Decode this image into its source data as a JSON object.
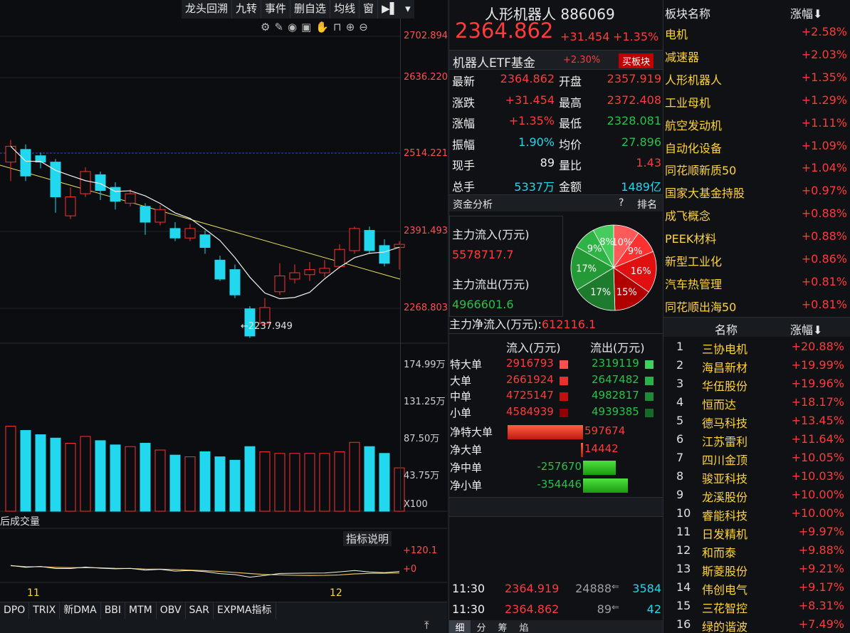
{
  "toolbar": {
    "items": [
      "龙头回溯",
      "九转",
      "事件",
      "删自选",
      "均线",
      "窗"
    ]
  },
  "price_axis": [
    "2702.894",
    "2636.220",
    "2514.221",
    "2391.493",
    "2268.803"
  ],
  "low_label": "2237.949",
  "volume_axis": [
    "174.99万",
    "131.25万",
    "87.50万",
    "43.75万"
  ],
  "volume_unit": "X100",
  "volume_caption": "后成交量",
  "indicator_axis": [
    "+120.1",
    "+0"
  ],
  "indicator_button": "指标说明",
  "time_labels": [
    "11",
    "12"
  ],
  "bottom_tabs": [
    "DPO",
    "TRIX",
    "新DMA",
    "BBI",
    "MTM",
    "OBV",
    "SAR",
    "EXPMA指标"
  ],
  "quote": {
    "name": "人形机器人 886069",
    "price": "2364.862",
    "change": "+31.454",
    "change_pct": "+1.35%",
    "etf_name": "机器人ETF基金",
    "etf_pct": "+2.30%",
    "buy_button": "买板块",
    "fields": [
      {
        "k1": "最新",
        "v1": "2364.862",
        "k2": "开盘",
        "v2": "2357.919",
        "c1": "red",
        "c2": "red"
      },
      {
        "k1": "涨跌",
        "v1": "+31.454",
        "k2": "最高",
        "v2": "2372.408",
        "c1": "red",
        "c2": "red"
      },
      {
        "k1": "涨幅",
        "v1": "+1.35%",
        "k2": "最低",
        "v2": "2328.081",
        "c1": "red",
        "c2": "green"
      },
      {
        "k1": "振幅",
        "v1": "1.90%",
        "k2": "均价",
        "v2": "27.896",
        "c1": "cyan",
        "c2": "green"
      },
      {
        "k1": "现手",
        "v1": "89",
        "k2": "量比",
        "v2": "1.43",
        "c1": "white",
        "c2": "red"
      },
      {
        "k1": "总手",
        "v1": "5337万",
        "k2": "金额",
        "v2": "1489亿",
        "c1": "cyan",
        "c2": "cyan"
      }
    ]
  },
  "fund": {
    "title": "资金分析",
    "help": "?",
    "rank": "排名",
    "inflow_label": "主力流入(万元)",
    "inflow_value": "5578717.7",
    "outflow_label": "主力流出(万元)",
    "outflow_value": "4966601.6",
    "net_label": "主力净流入(万元):",
    "net_value": "612116.1",
    "pie": [
      {
        "label": "10%",
        "value": 10,
        "color": "#ff5a5a"
      },
      {
        "label": "9%",
        "value": 9,
        "color": "#ff3030"
      },
      {
        "label": "16%",
        "value": 16,
        "color": "#e01010"
      },
      {
        "label": "15%",
        "value": 15,
        "color": "#b00000"
      },
      {
        "label": "17%",
        "value": 17,
        "color": "#1e7a2c"
      },
      {
        "label": "17%",
        "value": 17,
        "color": "#249a36"
      },
      {
        "label": "9%",
        "value": 9,
        "color": "#2eb444"
      },
      {
        "label": "8%",
        "value": 8,
        "color": "#46cc5c"
      }
    ],
    "col_in": "流入(万元)",
    "col_out": "流出(万元)",
    "rows": [
      {
        "name": "特大单",
        "in": "2916793",
        "out": "2319119"
      },
      {
        "name": "大单",
        "in": "2661924",
        "out": "2647482"
      },
      {
        "name": "中单",
        "in": "4725147",
        "out": "4982817"
      },
      {
        "name": "小单",
        "in": "4584939",
        "out": "4939385"
      }
    ],
    "net_rows": [
      {
        "name": "净特大单",
        "value": "597674",
        "num": 597674
      },
      {
        "name": "净大单",
        "value": "14442",
        "num": 14442
      },
      {
        "name": "净中单",
        "value": "-257670",
        "num": -257670
      },
      {
        "name": "净小单",
        "value": "-354446",
        "num": -354446
      }
    ]
  },
  "ticks": [
    {
      "time": "11:30",
      "price": "2364.919",
      "vol": "24888",
      "last": "3584"
    },
    {
      "time": "11:30",
      "price": "2364.862",
      "vol": "89",
      "last": "42"
    }
  ],
  "mid_tabs": [
    "细",
    "分",
    "筹",
    "焰"
  ],
  "sectors": {
    "col_name": "板块名称",
    "col_pct": "涨幅",
    "items": [
      {
        "name": "电机",
        "pct": "+2.58%"
      },
      {
        "name": "减速器",
        "pct": "+2.03%"
      },
      {
        "name": "人形机器人",
        "pct": "+1.35%"
      },
      {
        "name": "工业母机",
        "pct": "+1.29%"
      },
      {
        "name": "航空发动机",
        "pct": "+1.11%"
      },
      {
        "name": "自动化设备",
        "pct": "+1.09%"
      },
      {
        "name": "同花顺新质50",
        "pct": "+1.04%"
      },
      {
        "name": "国家大基金持股",
        "pct": "+0.97%"
      },
      {
        "name": "成飞概念",
        "pct": "+0.88%"
      },
      {
        "name": "PEEK材料",
        "pct": "+0.88%"
      },
      {
        "name": "新型工业化",
        "pct": "+0.86%"
      },
      {
        "name": "汽车热管理",
        "pct": "+0.81%"
      },
      {
        "name": "同花顺出海50",
        "pct": "+0.81%"
      }
    ]
  },
  "stocks": {
    "col_name": "名称",
    "col_pct": "涨幅",
    "items": [
      {
        "i": "1",
        "name": "三协电机",
        "pct": "+20.88%"
      },
      {
        "i": "2",
        "name": "海昌新材",
        "pct": "+19.99%"
      },
      {
        "i": "3",
        "name": "华伍股份",
        "pct": "+19.96%"
      },
      {
        "i": "4",
        "name": "恒而达",
        "pct": "+18.17%"
      },
      {
        "i": "5",
        "name": "德马科技",
        "pct": "+13.45%"
      },
      {
        "i": "6",
        "name": "江苏雷利",
        "pct": "+11.64%"
      },
      {
        "i": "7",
        "name": "四川金顶",
        "pct": "+10.05%"
      },
      {
        "i": "8",
        "name": "骏亚科技",
        "pct": "+10.03%"
      },
      {
        "i": "9",
        "name": "龙溪股份",
        "pct": "+10.00%"
      },
      {
        "i": "10",
        "name": "睿能科技",
        "pct": "+10.00%"
      },
      {
        "i": "11",
        "name": "日发精机",
        "pct": "+9.97%"
      },
      {
        "i": "12",
        "name": "和而泰",
        "pct": "+9.88%"
      },
      {
        "i": "13",
        "name": "斯菱股份",
        "pct": "+9.21%"
      },
      {
        "i": "14",
        "name": "伟创电气",
        "pct": "+9.17%"
      },
      {
        "i": "15",
        "name": "三花智控",
        "pct": "+8.31%"
      },
      {
        "i": "16",
        "name": "绿的谐波",
        "pct": "+7.49%"
      }
    ]
  },
  "candles": [
    {
      "o": 2500,
      "c": 2525,
      "h": 2535,
      "l": 2470,
      "v": 100
    },
    {
      "o": 2520,
      "c": 2478,
      "h": 2528,
      "l": 2470,
      "v": 95
    },
    {
      "o": 2510,
      "c": 2500,
      "h": 2515,
      "l": 2490,
      "v": 90
    },
    {
      "o": 2500,
      "c": 2445,
      "h": 2505,
      "l": 2420,
      "v": 86
    },
    {
      "o": 2415,
      "c": 2445,
      "h": 2460,
      "l": 2410,
      "v": 80
    },
    {
      "o": 2450,
      "c": 2485,
      "h": 2492,
      "l": 2445,
      "v": 88
    },
    {
      "o": 2480,
      "c": 2455,
      "h": 2485,
      "l": 2440,
      "v": 83
    },
    {
      "o": 2460,
      "c": 2438,
      "h": 2468,
      "l": 2425,
      "v": 78
    },
    {
      "o": 2435,
      "c": 2450,
      "h": 2457,
      "l": 2430,
      "v": 76
    },
    {
      "o": 2430,
      "c": 2405,
      "h": 2435,
      "l": 2385,
      "v": 80
    },
    {
      "o": 2405,
      "c": 2425,
      "h": 2432,
      "l": 2400,
      "v": 72
    },
    {
      "o": 2395,
      "c": 2380,
      "h": 2405,
      "l": 2375,
      "v": 66
    },
    {
      "o": 2380,
      "c": 2395,
      "h": 2402,
      "l": 2375,
      "v": 64
    },
    {
      "o": 2385,
      "c": 2365,
      "h": 2392,
      "l": 2355,
      "v": 70
    },
    {
      "o": 2345,
      "c": 2315,
      "h": 2352,
      "l": 2312,
      "v": 64
    },
    {
      "o": 2330,
      "c": 2290,
      "h": 2338,
      "l": 2285,
      "v": 60
    },
    {
      "o": 2268,
      "c": 2225,
      "h": 2272,
      "l": 2222,
      "v": 76
    },
    {
      "o": 2245,
      "c": 2270,
      "h": 2285,
      "l": 2240,
      "v": 70
    },
    {
      "o": 2295,
      "c": 2320,
      "h": 2340,
      "l": 2290,
      "v": 68
    },
    {
      "o": 2315,
      "c": 2325,
      "h": 2338,
      "l": 2308,
      "v": 68
    },
    {
      "o": 2322,
      "c": 2330,
      "h": 2342,
      "l": 2312,
      "v": 68
    },
    {
      "o": 2325,
      "c": 2332,
      "h": 2345,
      "l": 2318,
      "v": 68
    },
    {
      "o": 2335,
      "c": 2362,
      "h": 2370,
      "l": 2332,
      "v": 70
    },
    {
      "o": 2360,
      "c": 2395,
      "h": 2398,
      "l": 2355,
      "v": 81
    },
    {
      "o": 2392,
      "c": 2360,
      "h": 2398,
      "l": 2355,
      "v": 76
    },
    {
      "o": 2368,
      "c": 2340,
      "h": 2378,
      "l": 2335,
      "v": 68
    },
    {
      "o": 2365,
      "c": 2370,
      "h": 2375,
      "l": 2330,
      "v": 51
    }
  ]
}
